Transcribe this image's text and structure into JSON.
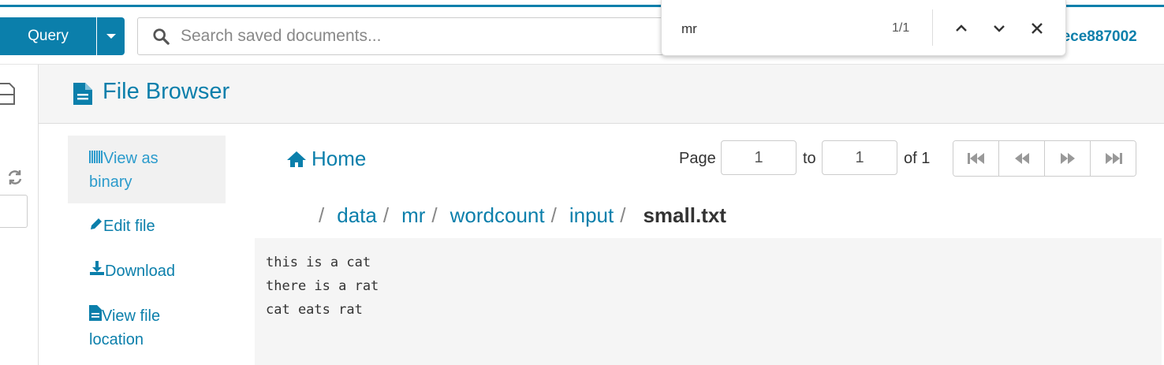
{
  "topbar": {
    "query_label": "Query",
    "search_placeholder": "Search saved documents...",
    "username": "hece887002",
    "accent_color": "#0b7fab"
  },
  "find_bar": {
    "text": "mr",
    "count": "1/1"
  },
  "header": {
    "title": "File Browser"
  },
  "side_menu": {
    "items": [
      {
        "label": "View as binary",
        "icon": "barcode-icon"
      },
      {
        "label": "Edit file",
        "icon": "pencil-icon"
      },
      {
        "label": "Download",
        "icon": "download-icon"
      },
      {
        "label": "View file location",
        "icon": "file-icon"
      }
    ]
  },
  "home_label": "Home",
  "pager": {
    "page_label": "Page",
    "from_value": "1",
    "to_label": "to",
    "to_value": "1",
    "of_label": "of 1"
  },
  "breadcrumb": {
    "parts": [
      "data",
      "mr",
      "wordcount",
      "input"
    ],
    "current": "small.txt"
  },
  "file_content": "this is a cat\nthere is a rat\ncat eats rat"
}
